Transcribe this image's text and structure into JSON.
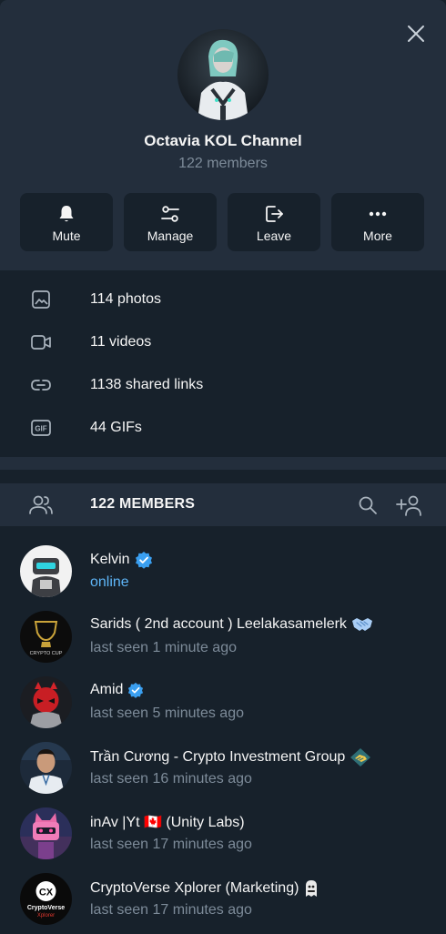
{
  "channel": {
    "title": "Octavia KOL Channel",
    "subtitle": "122 members"
  },
  "actions": [
    {
      "label": "Mute",
      "icon": "bell-icon"
    },
    {
      "label": "Manage",
      "icon": "sliders-icon"
    },
    {
      "label": "Leave",
      "icon": "exit-icon"
    },
    {
      "label": "More",
      "icon": "dots-icon"
    }
  ],
  "media": [
    {
      "label": "114 photos",
      "icon": "photo-icon"
    },
    {
      "label": "11 videos",
      "icon": "video-icon"
    },
    {
      "label": "1138 shared links",
      "icon": "link-icon"
    },
    {
      "label": "44 GIFs",
      "icon": "gif-icon"
    }
  ],
  "members_section": {
    "title": "122 MEMBERS"
  },
  "members": [
    {
      "name": "Kelvin",
      "status": "online",
      "online": true
    },
    {
      "name": "Sarids ( 2nd account ) Leelakasamelerk",
      "status": "last seen 1 minute ago"
    },
    {
      "name": "Amid",
      "status": "last seen 5 minutes ago"
    },
    {
      "name": "Trần Cương - Crypto Investment Group",
      "status": "last seen 16 minutes ago"
    },
    {
      "name": "inAv |Yt 🇨🇦 (Unity Labs)",
      "status": "last seen 17 minutes ago"
    },
    {
      "name": "CryptoVerse Xplorer (Marketing)",
      "status": "last seen 17 minutes ago"
    }
  ],
  "logos": {
    "crypto_cup": "CRYPTO CUP",
    "cryptoverse_line1": "CryptoVerse",
    "cryptoverse_line2": "Xplorer",
    "cryptoverse_mark": "CX"
  },
  "colors": {
    "accent": "#5eb5f7",
    "verified": "#3a9ff0",
    "header_bg": "#232e3c",
    "page_bg": "#17212b"
  }
}
